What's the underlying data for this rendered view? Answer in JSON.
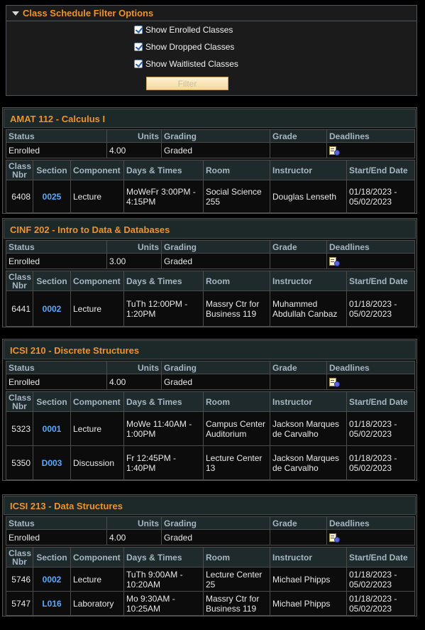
{
  "filter": {
    "title": "Class Schedule Filter Options",
    "options": [
      {
        "label": "Show Enrolled Classes",
        "checked": true
      },
      {
        "label": "Show Dropped Classes",
        "checked": true
      },
      {
        "label": "Show Waitlisted Classes",
        "checked": true
      }
    ],
    "button_label": "Filter"
  },
  "headers": {
    "status": "Status",
    "units": "Units",
    "grading": "Grading",
    "grade": "Grade",
    "deadlines": "Deadlines",
    "class_nbr": "Class Nbr",
    "section": "Section",
    "component": "Component",
    "days_times": "Days & Times",
    "room": "Room",
    "instructor": "Instructor",
    "start_end": "Start/End Date"
  },
  "courses": [
    {
      "title": "AMAT 112 - Calculus I",
      "status": "Enrolled",
      "units": "4.00",
      "grading": "Graded",
      "grade": "",
      "classes": [
        {
          "nbr": "6408",
          "section": "0025",
          "component": "Lecture",
          "days_times": "MoWeFr 3:00PM - 4:15PM",
          "room": "Social Science 255",
          "instructor": "Douglas Lenseth",
          "dates": "01/18/2023 - 05/02/2023"
        }
      ]
    },
    {
      "title": "CINF 202 - Intro to Data & Databases",
      "status": "Enrolled",
      "units": "3.00",
      "grading": "Graded",
      "grade": "",
      "classes": [
        {
          "nbr": "6441",
          "section": "0002",
          "component": "Lecture",
          "days_times": "TuTh 12:00PM - 1:20PM",
          "room": "Massry Ctr for Business 119",
          "instructor": "Muhammed Abdullah Canbaz",
          "dates": "01/18/2023 - 05/02/2023"
        }
      ]
    },
    {
      "title": "ICSI 210 - Discrete Structures",
      "status": "Enrolled",
      "units": "4.00",
      "grading": "Graded",
      "grade": "",
      "classes": [
        {
          "nbr": "5323",
          "section": "0001",
          "component": "Lecture",
          "days_times": "MoWe 11:40AM - 1:00PM",
          "room": "Campus Center Auditorium",
          "instructor": "Jackson Marques de Carvalho",
          "dates": "01/18/2023 - 05/02/2023"
        },
        {
          "nbr": "5350",
          "section": "D003",
          "component": "Discussion",
          "days_times": "Fr 12:45PM - 1:40PM",
          "room": "Lecture Center 13",
          "instructor": "Jackson Marques de Carvalho",
          "dates": "01/18/2023 - 05/02/2023"
        }
      ]
    },
    {
      "title": "ICSI 213 - Data Structures",
      "status": "Enrolled",
      "units": "4.00",
      "grading": "Graded",
      "grade": "",
      "classes": [
        {
          "nbr": "5746",
          "section": "0002",
          "component": "Lecture",
          "days_times": "TuTh 9:00AM - 10:20AM",
          "room": "Lecture Center 25",
          "instructor": "Michael Phipps",
          "dates": "01/18/2023 - 05/02/2023"
        },
        {
          "nbr": "5747",
          "section": "L016",
          "component": "Laboratory",
          "days_times": "Mo 9:30AM - 10:25AM",
          "room": "Massry Ctr for Business 119",
          "instructor": "Michael Phipps",
          "dates": "01/18/2023 - 05/02/2023"
        }
      ]
    }
  ],
  "icons": {
    "collapse": "triangle-down-icon",
    "deadlines": "calendar-deadline-icon"
  },
  "colors": {
    "title_accent": "#f0922c",
    "link": "#5aa9ff",
    "header_text": "#a7b6c2"
  }
}
